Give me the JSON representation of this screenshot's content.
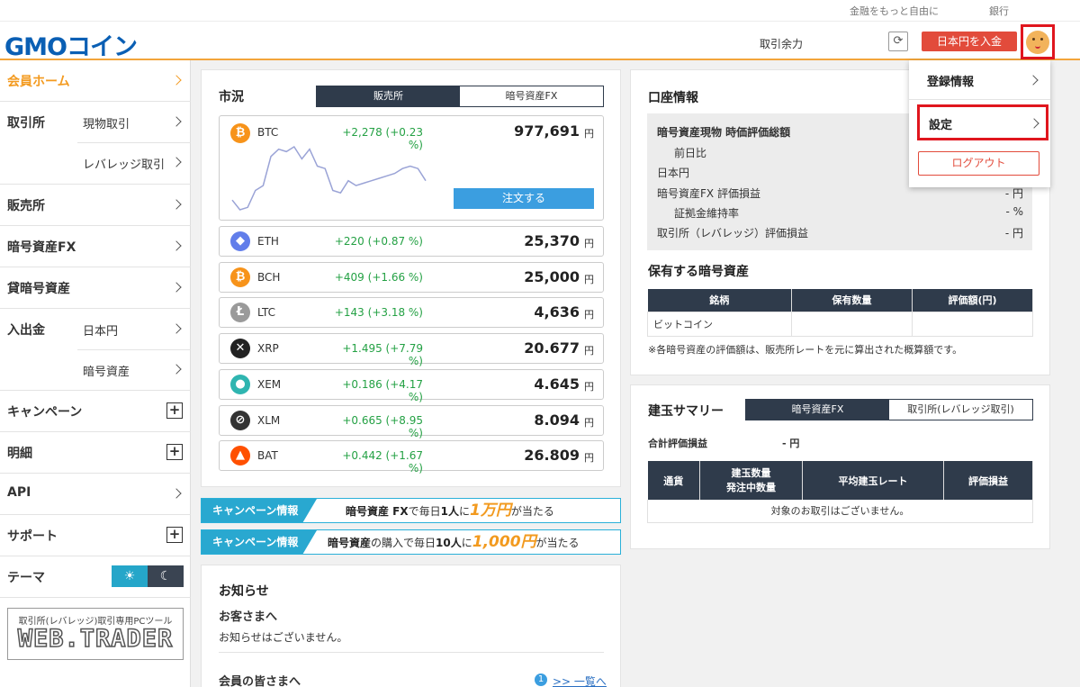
{
  "topbar": {
    "link1": "金融をもっと自由に",
    "link2": "銀行"
  },
  "header": {
    "logo": "GMOコイン",
    "balance_label": "取引余力",
    "deposit_button": "日本円を入金"
  },
  "sidebar": {
    "home": "会員ホーム",
    "exchange": "取引所",
    "exchange_sub1": "現物取引",
    "exchange_sub2": "レバレッジ取引",
    "sales": "販売所",
    "crypto_fx": "暗号資産FX",
    "lending": "貸暗号資産",
    "deposit": "入出金",
    "deposit_sub1": "日本円",
    "deposit_sub2": "暗号資産",
    "campaign": "キャンペーン",
    "details": "明細",
    "api": "API",
    "support": "サポート",
    "theme": "テーマ",
    "theme_light": "☀",
    "theme_dark": "☾",
    "webtrader_small": "取引所(レバレッジ)取引専用PCツール",
    "webtrader_big": "WEB.TRADER"
  },
  "market": {
    "title": "市況",
    "tab_active": "販売所",
    "tab_inactive": "暗号資産FX",
    "order_button": "注文する",
    "unit": "円",
    "coins": [
      {
        "symbol": "BTC",
        "change": "+2,278 (+0.23 %)",
        "price": "977,691",
        "icon": "bitcoin-icon",
        "color": "#f7931a",
        "glyph": "₿"
      },
      {
        "symbol": "ETH",
        "change": "+220 (+0.87 %)",
        "price": "25,370",
        "icon": "ethereum-icon",
        "color": "#627eea",
        "glyph": "◆"
      },
      {
        "symbol": "BCH",
        "change": "+409 (+1.66 %)",
        "price": "25,000",
        "icon": "bitcoin-cash-icon",
        "color": "#f7931a",
        "glyph": "₿"
      },
      {
        "symbol": "LTC",
        "change": "+143 (+3.18 %)",
        "price": "4,636",
        "icon": "litecoin-icon",
        "color": "#9a9a9a",
        "glyph": "Ł"
      },
      {
        "symbol": "XRP",
        "change": "+1.495 (+7.79 %)",
        "price": "20.677",
        "icon": "xrp-icon",
        "color": "#222222",
        "glyph": "✕"
      },
      {
        "symbol": "XEM",
        "change": "+0.186 (+4.17 %)",
        "price": "4.645",
        "icon": "xem-icon",
        "color": "#2fb5b0",
        "glyph": "●"
      },
      {
        "symbol": "XLM",
        "change": "+0.665 (+8.95 %)",
        "price": "8.094",
        "icon": "stellar-icon",
        "color": "#333333",
        "glyph": "⊘"
      },
      {
        "symbol": "BAT",
        "change": "+0.442 (+1.67 %)",
        "price": "26.809",
        "icon": "bat-icon",
        "color": "#ff5000",
        "glyph": "▲"
      }
    ],
    "sparkline": [
      9,
      5,
      6,
      13,
      15,
      27,
      30,
      29,
      31,
      26,
      30,
      23,
      22,
      13,
      12,
      17,
      15,
      16,
      17,
      18,
      19,
      20,
      22,
      23,
      22,
      17
    ]
  },
  "banners": [
    {
      "tag": "キャンペーン情報",
      "pre": "暗号資産 FX",
      "mid": "で毎日",
      "bold": "1人",
      "mid2": "に",
      "amount": "1万円",
      "post": "が当たる"
    },
    {
      "tag": "キャンペーン情報",
      "pre": "暗号資産",
      "mid": "の購入で毎日",
      "bold": "10人",
      "mid2": "に",
      "amount": "1,000円",
      "post": "が当たる"
    }
  ],
  "news": {
    "title": "お知らせ",
    "guest_heading": "お客さまへ",
    "guest_text": "お知らせはございません。",
    "member_heading": "会員の皆さまへ",
    "badge": "1",
    "list_link": ">> 一覧へ"
  },
  "account": {
    "title": "口座情報",
    "rows": [
      {
        "label": "暗号資産現物 時価評価総額",
        "value": ""
      },
      {
        "label": "前日比",
        "value": ""
      },
      {
        "label": "日本円",
        "value": ""
      },
      {
        "label": "暗号資産FX 評価損益",
        "value": "- 円"
      },
      {
        "label": "証拠金維持率",
        "value": "- %"
      },
      {
        "label": "取引所（レバレッジ）評価損益",
        "value": "- 円"
      }
    ],
    "holdings_title": "保有する暗号資産",
    "holdings_headers": [
      "銘柄",
      "保有数量",
      "評価額(円)"
    ],
    "holdings_row": [
      "ビットコイン",
      "",
      ""
    ],
    "note": "※各暗号資産の評価額は、販売所レートを元に算出された概算額です。"
  },
  "positions": {
    "title": "建玉サマリー",
    "tab_active": "暗号資産FX",
    "tab_inactive": "取引所(レバレッジ取引)",
    "total_label": "合計評価損益",
    "total_value": "- 円",
    "headers": [
      "通貨",
      "建玉数量\n発注中数量",
      "平均建玉レート",
      "評価損益"
    ],
    "empty": "対象のお取引はございません。"
  },
  "dropdown": {
    "registration": "登録情報",
    "settings": "設定",
    "logout": "ログアウト"
  },
  "colors": {
    "accent": "#f3a53b",
    "header_blue": "#0a5fb4",
    "positive": "#24a144",
    "danger": "#e24b3b",
    "table_head": "#2f3b4b"
  }
}
